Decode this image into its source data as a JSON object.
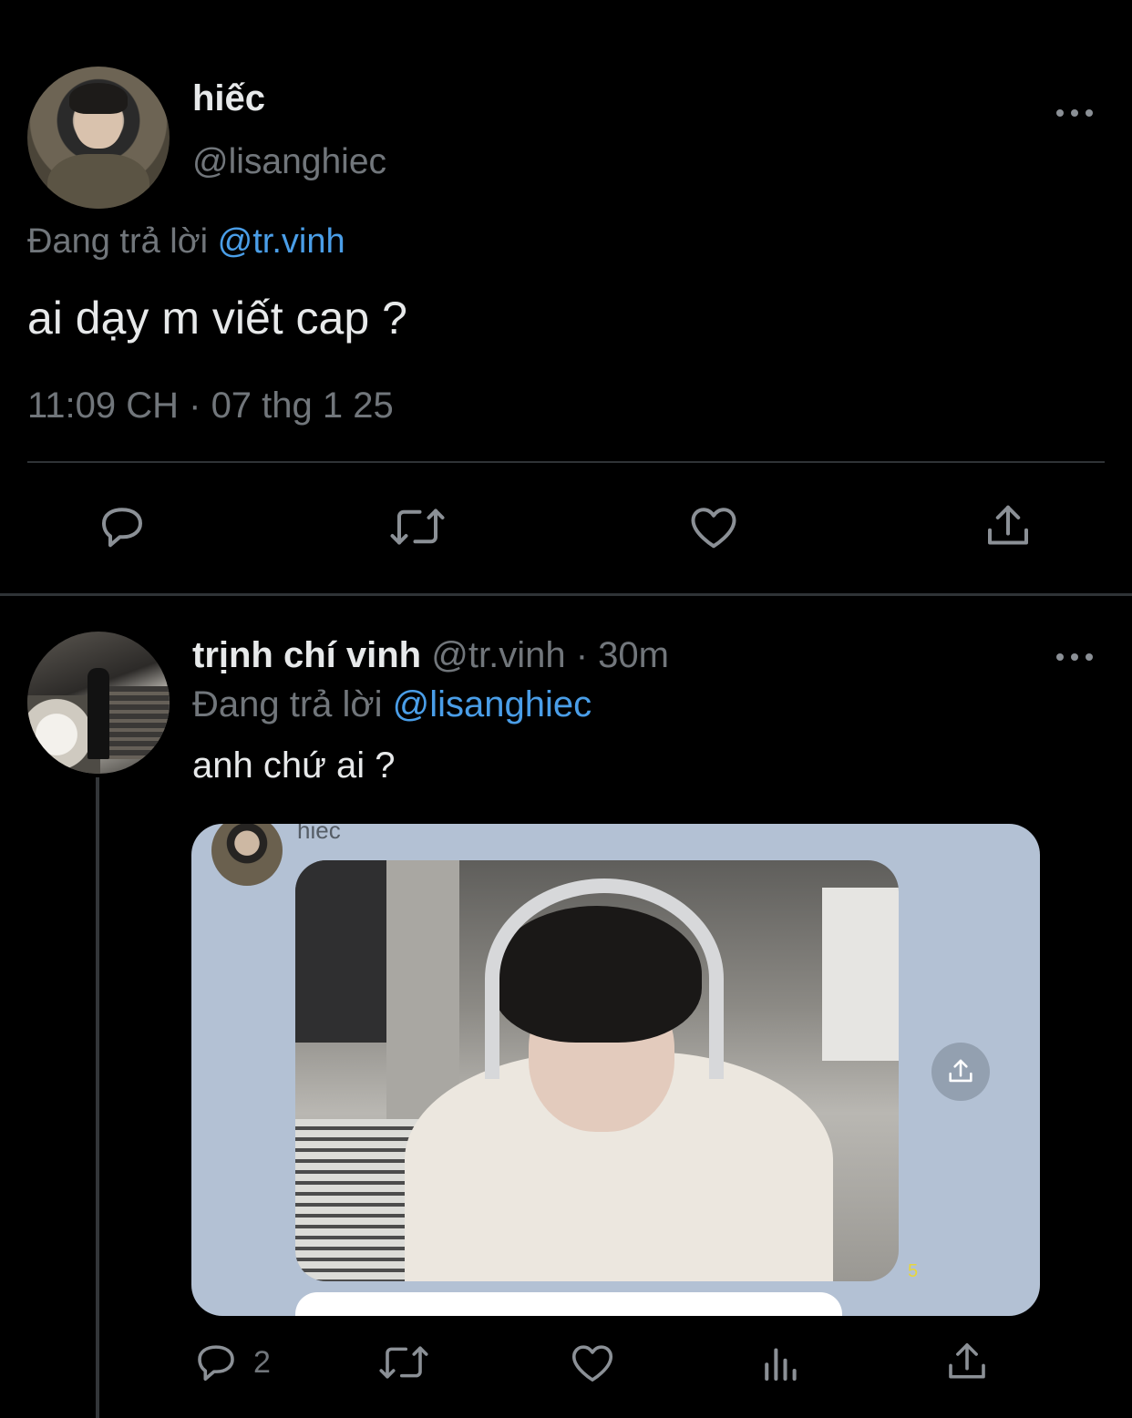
{
  "main_tweet": {
    "display_name": "hiếc",
    "handle": "@lisanghiec",
    "replying_label": "Đang trả lời",
    "replying_to": "@tr.vinh",
    "text": "ai dạy m viết cap ?",
    "timestamp": "11:09 CH · 07 thg 1 25",
    "actions": [
      "reply-icon",
      "retweet-icon",
      "like-icon",
      "share-icon"
    ]
  },
  "reply_tweet": {
    "display_name": "trịnh chí vinh",
    "handle": "@tr.vinh",
    "separator": "·",
    "time": "30m",
    "replying_label": "Đang trả lời",
    "replying_to": "@lisanghiec",
    "text": "anh chứ ai ?",
    "media": {
      "name": "hiec",
      "count": "5"
    },
    "reply_count": "2",
    "actions": [
      "reply-icon",
      "retweet-icon",
      "like-icon",
      "views-icon",
      "share-icon"
    ]
  },
  "colors": {
    "background": "#000000",
    "text_primary": "#e7e9ea",
    "text_secondary": "#71767b",
    "link": "#4a9ee8",
    "divider": "#2f3336",
    "media_card_bg": "#b3c1d4"
  }
}
